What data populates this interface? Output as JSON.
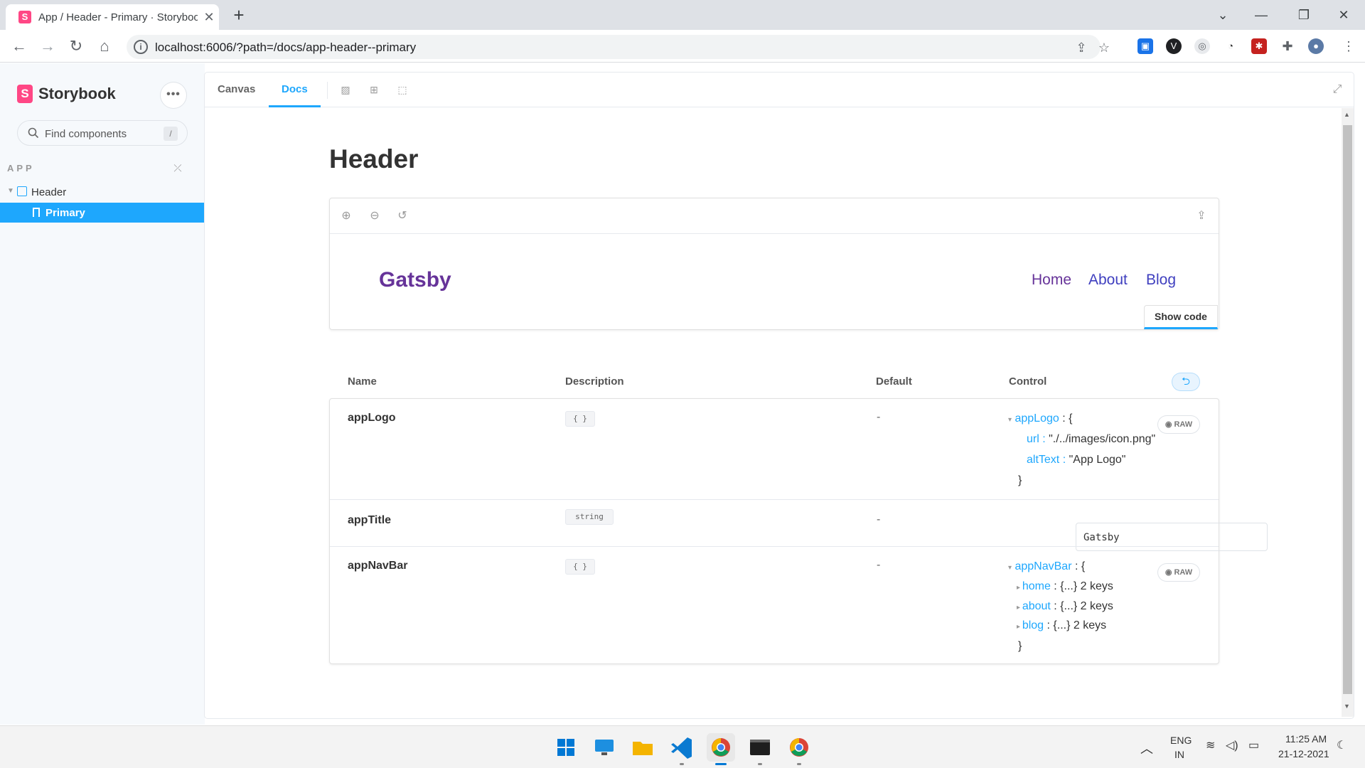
{
  "browser": {
    "tab_title": "App / Header - Primary · Storybook",
    "tab_close": "✕",
    "new_tab": "+",
    "url": "localhost:6006/?path=/docs/app-header--primary"
  },
  "sidebar": {
    "brand": "Storybook",
    "menu_label": "•••",
    "search_placeholder": "Find components",
    "search_shortcut": "/",
    "group_label": "APP",
    "tree": {
      "header_label": "Header",
      "primary_label": "Primary"
    }
  },
  "toolbar": {
    "tabs": [
      {
        "label": "Canvas"
      },
      {
        "label": "Docs"
      }
    ]
  },
  "docs": {
    "title": "Header",
    "preview": {
      "logo": "Gatsby",
      "nav": [
        "Home",
        "About",
        "Blog"
      ],
      "show_code": "Show code"
    },
    "table": {
      "headers": {
        "name": "Name",
        "description": "Description",
        "default": "Default",
        "control": "Control"
      },
      "rows": [
        {
          "name": "appLogo",
          "type": "{ }",
          "default": "-",
          "control": {
            "key": "appLogo",
            "open": " : {",
            "entries": [
              {
                "key": "url",
                "value": "\"./../images/icon.png\""
              },
              {
                "key": "altText",
                "value": "\"App Logo\""
              }
            ],
            "close": "}",
            "raw": "RAW"
          }
        },
        {
          "name": "appTitle",
          "type": "string",
          "default": "-",
          "control": {
            "value": "Gatsby"
          }
        },
        {
          "name": "appNavBar",
          "type": "{ }",
          "default": "-",
          "control": {
            "key": "appNavBar",
            "open": " : {",
            "entries": [
              {
                "key": "home",
                "value": "{...} 2 keys"
              },
              {
                "key": "about",
                "value": "{...} 2 keys"
              },
              {
                "key": "blog",
                "value": "{...} 2 keys"
              }
            ],
            "close": "}",
            "raw": "RAW"
          }
        }
      ]
    }
  },
  "taskbar": {
    "lang_line1": "ENG",
    "lang_line2": "IN",
    "time": "11:25 AM",
    "date": "21-12-2021"
  },
  "colors": {
    "storybook_accent": "#1ea7fd",
    "storybook_brand": "#ff4785",
    "gatsby_purple": "#663399"
  }
}
